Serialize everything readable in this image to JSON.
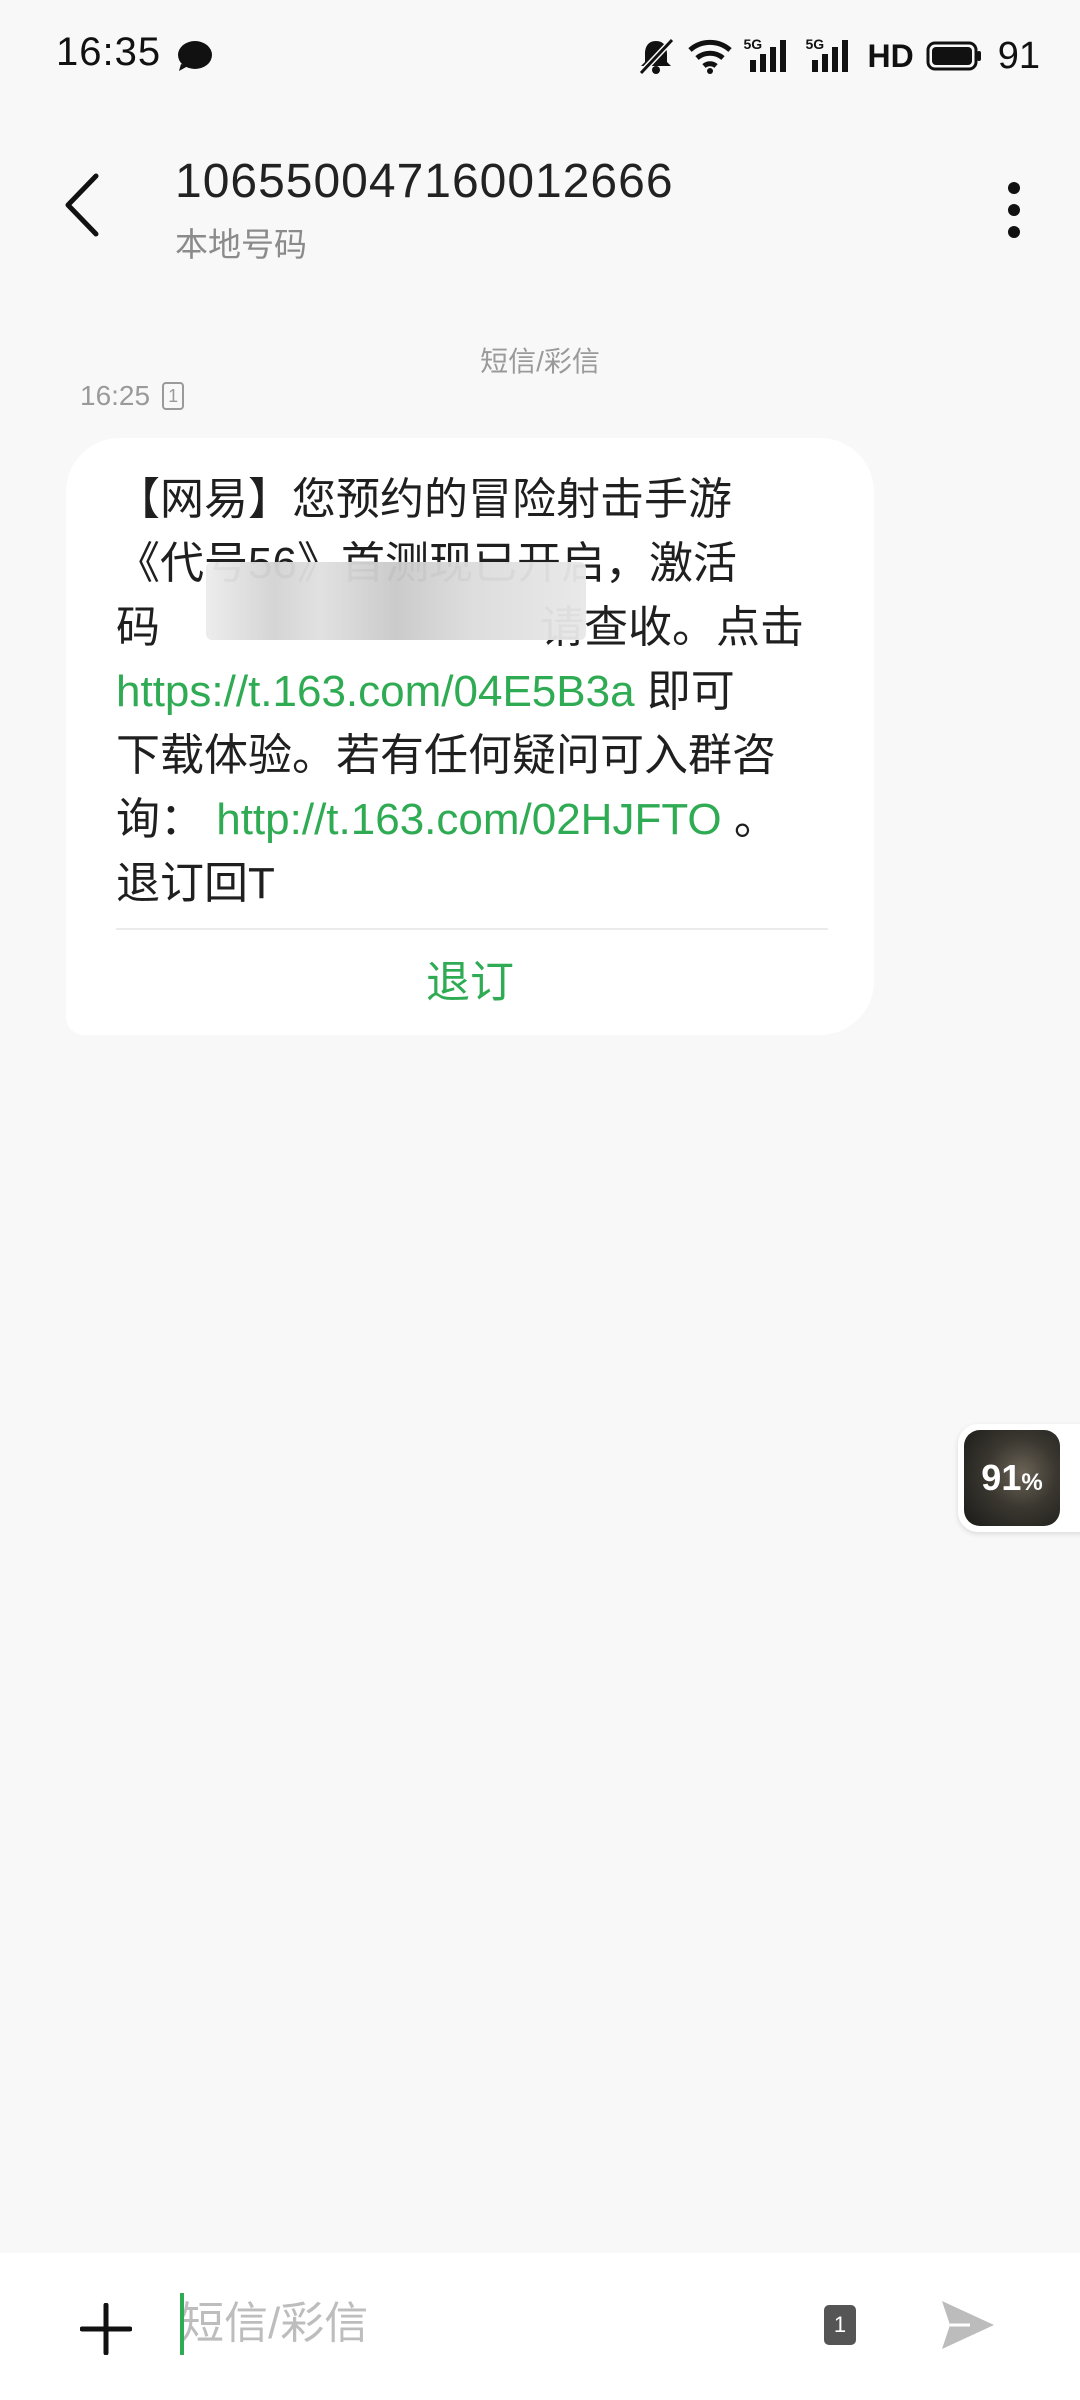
{
  "status_bar": {
    "time": "16:35",
    "network1": "5G",
    "network2": "5G",
    "hd": "HD",
    "battery": "91",
    "icons": [
      "chat-bubble-icon",
      "mute-icon",
      "wifi-icon",
      "signal-icon",
      "signal-icon",
      "hd-icon",
      "battery-icon"
    ]
  },
  "header": {
    "number": "10655004716001266​6",
    "subtitle": "本地号码"
  },
  "thread": {
    "type_label": "短信/彩信",
    "time": "16:25",
    "sim": "1"
  },
  "message": {
    "line1": "【网易】您预约的冒险射击手游",
    "line2": "《代号56》首测现已开启，激活",
    "line3_prefix": "码",
    "line3_suffix": "请查收。点击",
    "link1": "https://t.163.com/04E5B3a",
    "after_link1": " 即可",
    "line5": "下载体验。若有任何疑问可入群咨",
    "line6_prefix": "询：",
    "link2": "http://t.163.com/02HJFTO",
    "line6_suffix": " 。",
    "line7": "退订回T",
    "unsubscribe": "退订"
  },
  "widget": {
    "percent": "91",
    "unit": "%"
  },
  "composer": {
    "placeholder": "短信/彩信",
    "sim": "1"
  },
  "colors": {
    "accent": "#2fab53",
    "background": "#f8f8f8"
  }
}
